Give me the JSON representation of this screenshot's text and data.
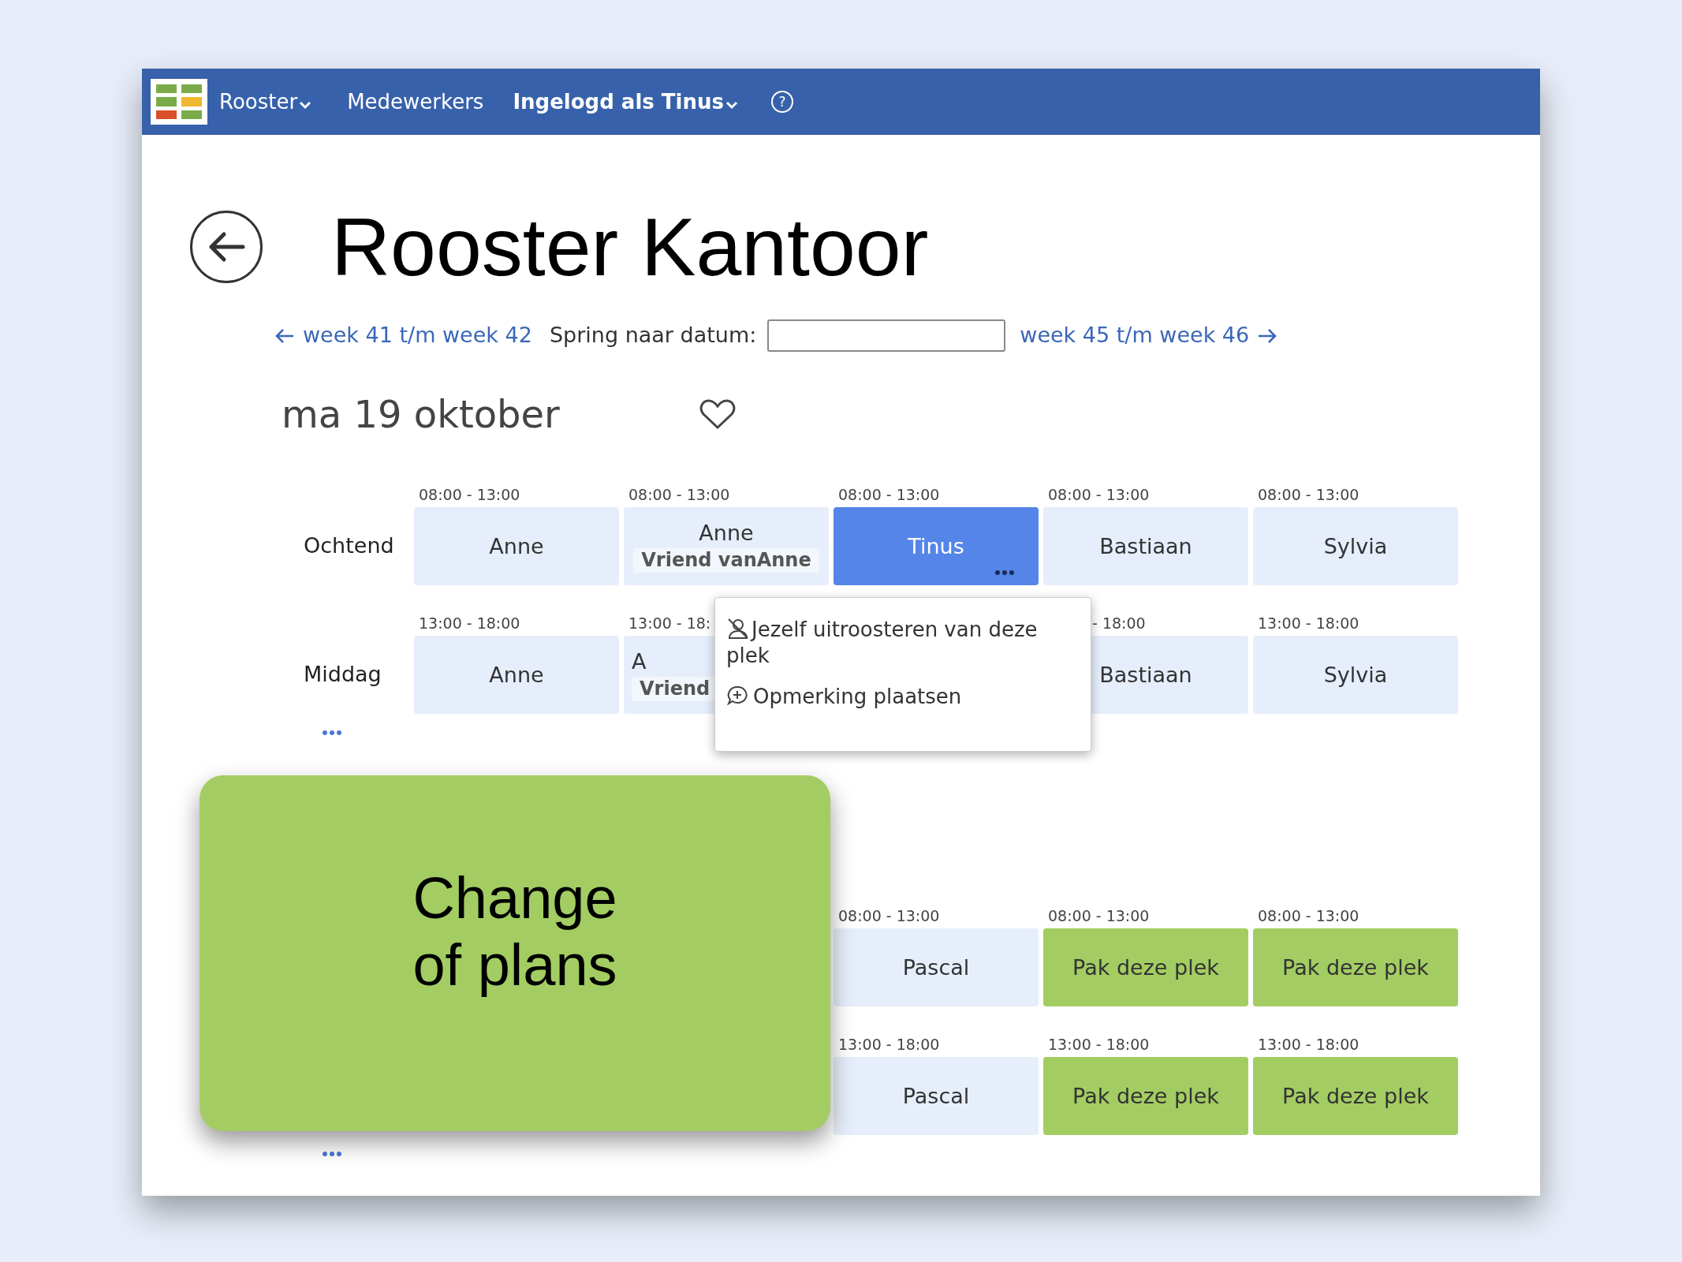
{
  "navbar": {
    "items": [
      {
        "label": "Rooster",
        "kind": "dropdown"
      },
      {
        "label": "Medewerkers",
        "kind": "link"
      },
      {
        "label": "Ingelogd als Tinus",
        "kind": "account"
      },
      {
        "label": "?",
        "kind": "help"
      }
    ]
  },
  "title": "Rooster Kantoor",
  "week_nav": {
    "prev": "week 41 t/m week 42",
    "jump_label": "Spring naar datum:",
    "next": "week 45 t/m week 46"
  },
  "days": [
    {
      "date": "ma 19 oktober",
      "favorite": false,
      "rows": [
        {
          "label": "Ochtend",
          "slots": [
            {
              "time": "08:00 - 13:00",
              "name": "Anne",
              "kind": "assigned"
            },
            {
              "time": "08:00 - 13:00",
              "name": "Anne",
              "sub": "Vriend vanAnne",
              "kind": "assigned"
            },
            {
              "time": "08:00 - 13:00",
              "name": "Tinus",
              "kind": "mine"
            },
            {
              "time": "08:00 - 13:00",
              "name": "Bastiaan",
              "kind": "assigned"
            },
            {
              "time": "08:00 - 13:00",
              "name": "Sylvia",
              "kind": "assigned"
            }
          ]
        },
        {
          "label": "Middag",
          "slots": [
            {
              "time": "13:00 - 18:00",
              "name": "Anne",
              "kind": "assigned"
            },
            {
              "time": "13:00 - 18:",
              "name": "A",
              "sub": "Vriend",
              "kind": "clipped"
            },
            {
              "kind": "hidden"
            },
            {
              "time": "- 18:00",
              "name": "Bastiaan",
              "kind": "offset"
            },
            {
              "time": "13:00 - 18:00",
              "name": "Sylvia",
              "kind": "assigned"
            }
          ]
        }
      ]
    },
    {
      "rows": [
        {
          "slots": [
            {
              "kind": "hidden"
            },
            {
              "kind": "hidden"
            },
            {
              "time": "08:00 - 13:00",
              "name": "Pascal",
              "kind": "assigned"
            },
            {
              "time": "08:00 - 13:00",
              "name": "Pak deze plek",
              "kind": "open"
            },
            {
              "time": "08:00 - 13:00",
              "name": "Pak deze plek",
              "kind": "open"
            }
          ]
        },
        {
          "slots": [
            {
              "kind": "hidden"
            },
            {
              "kind": "hidden"
            },
            {
              "time": "13:00 - 18:00",
              "name": "Pascal",
              "kind": "assigned"
            },
            {
              "time": "13:00 - 18:00",
              "name": "Pak deze plek",
              "kind": "open"
            },
            {
              "time": "13:00 - 18:00",
              "name": "Pak deze plek",
              "kind": "open"
            }
          ]
        }
      ]
    }
  ],
  "context_menu": {
    "items": [
      {
        "label": "Jezelf uitroosteren van deze plek",
        "kind": "unassign"
      },
      {
        "label": "Opmerking plaatsen",
        "kind": "comment"
      }
    ]
  },
  "callout": {
    "text": "Change of plans"
  }
}
